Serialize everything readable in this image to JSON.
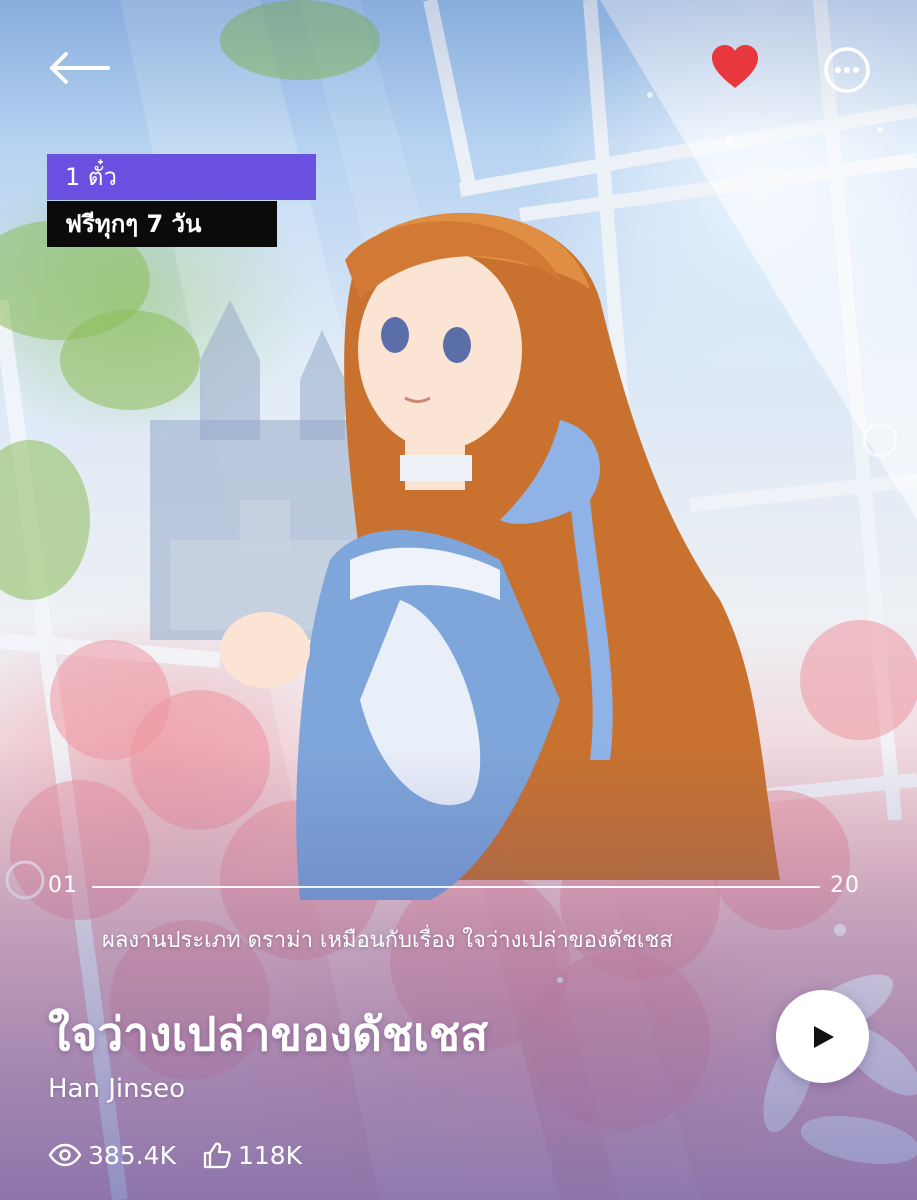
{
  "header": {
    "back_icon": "arrow-left-icon",
    "favorite_icon": "heart-icon",
    "favorite_color": "#e8373f",
    "more_icon": "more-horizontal-icon"
  },
  "badges": {
    "price": "1 ตั๋ว",
    "free_every": "ฟรีทุกๆ 7 วัน",
    "price_color": "#6b4fe0",
    "free_color": "#0b0b0b"
  },
  "episodes": {
    "first": "01",
    "last": "20"
  },
  "series": {
    "description": "ผลงานประเภท ดราม่า เหมือนกับเรื่อง ใจว่างเปล่าของดัชเชส",
    "title": "ใจว่างเปล่าของดัชเชส",
    "author": "Han Jinseo"
  },
  "stats": {
    "views": "385.4K",
    "likes": "118K",
    "views_icon": "eye-icon",
    "likes_icon": "thumbs-up-icon"
  },
  "play": {
    "icon": "play-icon"
  }
}
